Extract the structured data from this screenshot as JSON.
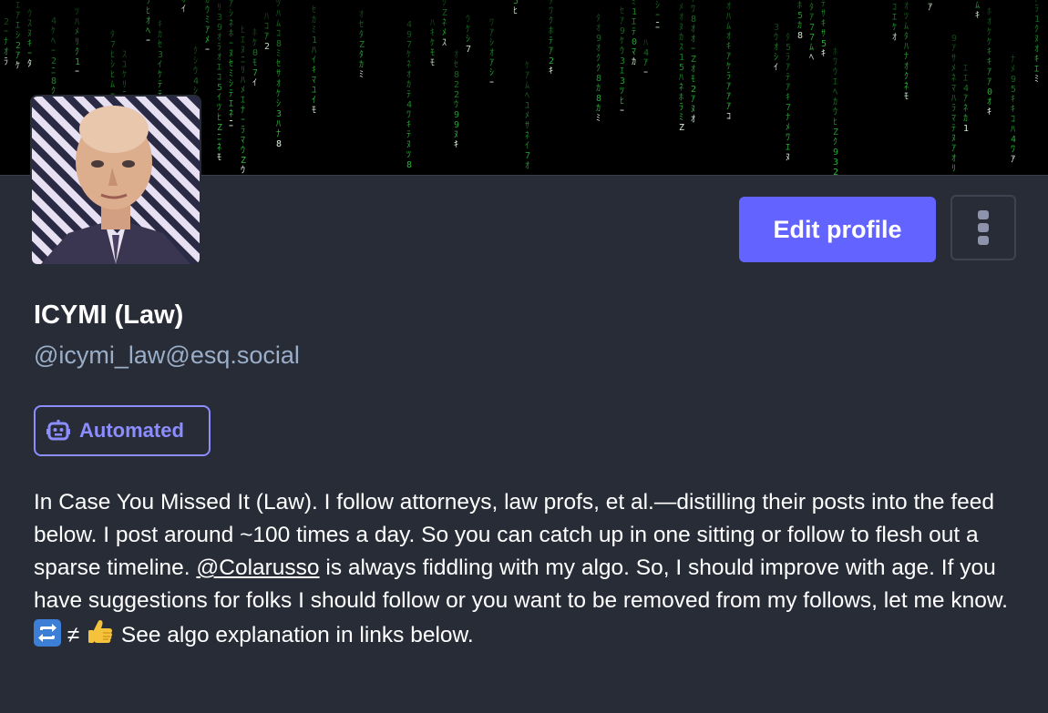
{
  "profile": {
    "display_name": "ICYMI (Law)",
    "handle": "@icymi_law@esq.social",
    "badge_label": "Automated",
    "edit_button_label": "Edit profile",
    "bio": {
      "part1": "In Case You Missed It (Law). I follow attorneys, law profs, et al.—distilling their posts into the feed below. I post around ~100 times a day. So you can catch up in one sitting or follow to flesh out a sparse timeline. ",
      "mention": "@Colarusso",
      "part2": " is always fiddling with my algo. So, I should improve with age. If you have suggestions for folks I should follow or you want to be removed from my follows, let me know. ",
      "not_equal": "≠",
      "part3": " See algo explanation in links below."
    }
  },
  "icons": {
    "banner": "matrix-code-rain",
    "badge": "robot-icon",
    "more": "vertical-ellipsis-icon",
    "emoji_1": "repeat-emoji",
    "emoji_2": "thumbs-up-emoji"
  },
  "colors": {
    "background": "#282c37",
    "accent": "#6364ff",
    "badge": "#8c8dff",
    "handle": "#9baec8",
    "matrix_green": "#2ecc40"
  }
}
